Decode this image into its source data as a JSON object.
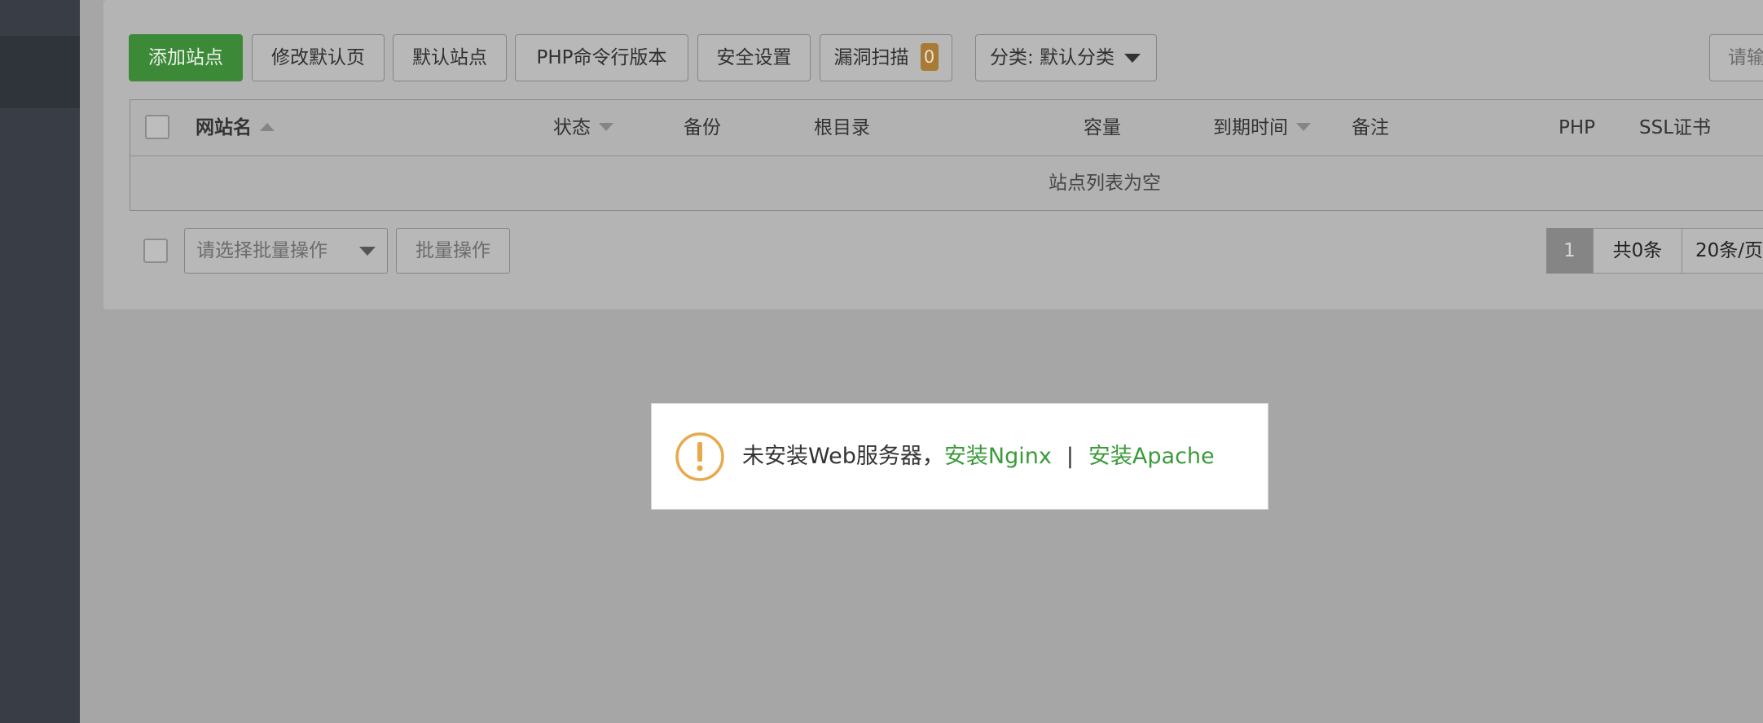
{
  "toolbar": {
    "add_site": "添加站点",
    "edit_default_page": "修改默认页",
    "default_site": "默认站点",
    "php_cli_version": "PHP命令行版本",
    "security_settings": "安全设置",
    "vuln_scan": "漏洞扫描",
    "vuln_count": "0",
    "category": "分类: 默认分类",
    "search_placeholder": "请输"
  },
  "table": {
    "columns": {
      "site_name": "网站名",
      "status": "状态",
      "backup": "备份",
      "root_dir": "根目录",
      "capacity": "容量",
      "expire_time": "到期时间",
      "remark": "备注",
      "php": "PHP",
      "ssl": "SSL证书"
    },
    "empty_text": "站点列表为空"
  },
  "bottom": {
    "batch_select_placeholder": "请选择批量操作",
    "batch_button": "批量操作",
    "current_page": "1",
    "total": "共0条",
    "page_size": "20条/页"
  },
  "toast": {
    "message": "未安装Web服务器，",
    "install_nginx": "安装Nginx",
    "separator": "|",
    "install_apache": "安装Apache"
  },
  "colors": {
    "primary_green": "#3c8a38",
    "link_green": "#3b9a3b",
    "warning_orange": "#e9a94a"
  }
}
